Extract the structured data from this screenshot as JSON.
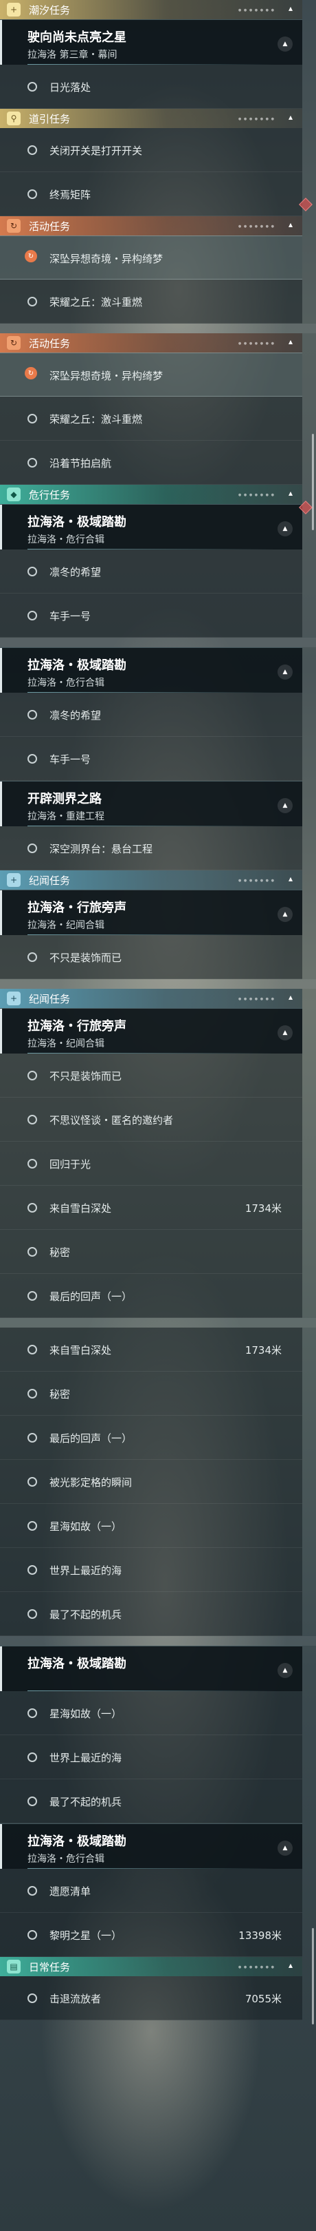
{
  "segments": [
    {
      "type": "cat",
      "style": "gold",
      "icon": "+",
      "icon_name": "sparkle-icon",
      "label": "潮汐任务"
    },
    {
      "type": "quest",
      "title": "驶向尚未点亮之星",
      "subtitle": "拉海洛 第三章・幕间"
    },
    {
      "type": "obj",
      "text": "日光落处"
    },
    {
      "type": "cat",
      "style": "gold",
      "icon": "⚲",
      "icon_name": "location-pin-icon",
      "label": "道引任务"
    },
    {
      "type": "obj",
      "text": "关闭开关是打开开关"
    },
    {
      "type": "obj",
      "text": "终焉矩阵"
    },
    {
      "type": "cat",
      "style": "orange",
      "icon": "↻",
      "icon_name": "cycle-icon",
      "label": "活动任务"
    },
    {
      "type": "obj",
      "text": "深坠异想奇境・异构绮梦",
      "selected": true
    },
    {
      "type": "obj",
      "text": "荣耀之丘：激斗重燃"
    },
    {
      "type": "sep"
    },
    {
      "type": "cat",
      "style": "orange",
      "icon": "↻",
      "icon_name": "cycle-icon",
      "label": "活动任务"
    },
    {
      "type": "obj",
      "text": "深坠异想奇境・异构绮梦",
      "selected": true
    },
    {
      "type": "obj",
      "text": "荣耀之丘：激斗重燃"
    },
    {
      "type": "obj",
      "text": "沿着节拍启航"
    },
    {
      "type": "cat",
      "style": "green",
      "icon": "◆",
      "icon_name": "danger-icon",
      "label": "危行任务"
    },
    {
      "type": "quest",
      "title": "拉海洛・极域踏勘",
      "subtitle": "拉海洛・危行合辑"
    },
    {
      "type": "obj",
      "text": "凛冬的希望"
    },
    {
      "type": "obj",
      "text": "车手一号"
    },
    {
      "type": "sep"
    },
    {
      "type": "quest",
      "title": "拉海洛・极域踏勘",
      "subtitle": "拉海洛・危行合辑"
    },
    {
      "type": "obj",
      "text": "凛冬的希望"
    },
    {
      "type": "obj",
      "text": "车手一号"
    },
    {
      "type": "quest",
      "title": "开辟测界之路",
      "subtitle": "拉海洛・重建工程"
    },
    {
      "type": "obj",
      "text": "深空测界台：悬台工程"
    },
    {
      "type": "cat",
      "style": "blue",
      "icon": "+",
      "icon_name": "sparkle-icon",
      "label": "纪闻任务"
    },
    {
      "type": "quest",
      "title": "拉海洛・行旅旁声",
      "subtitle": "拉海洛・纪闻合辑"
    },
    {
      "type": "obj",
      "text": "不只是装饰而已"
    },
    {
      "type": "sep"
    },
    {
      "type": "cat",
      "style": "blue",
      "icon": "+",
      "icon_name": "sparkle-icon",
      "label": "纪闻任务"
    },
    {
      "type": "quest",
      "title": "拉海洛・行旅旁声",
      "subtitle": "拉海洛・纪闻合辑"
    },
    {
      "type": "obj",
      "text": "不只是装饰而已"
    },
    {
      "type": "obj",
      "text": "不思议怪谈・匿名的邀约者"
    },
    {
      "type": "obj",
      "text": "回归于光"
    },
    {
      "type": "obj",
      "text": "来自雪白深处",
      "distance": "1734米"
    },
    {
      "type": "obj",
      "text": "秘密"
    },
    {
      "type": "obj",
      "text": "最后的回声（一）"
    },
    {
      "type": "sep"
    },
    {
      "type": "obj",
      "text": "来自雪白深处",
      "distance": "1734米"
    },
    {
      "type": "obj",
      "text": "秘密"
    },
    {
      "type": "obj",
      "text": "最后的回声（一）"
    },
    {
      "type": "obj",
      "text": "被光影定格的瞬间"
    },
    {
      "type": "obj",
      "text": "星海如故（一）"
    },
    {
      "type": "obj",
      "text": "世界上最近的海"
    },
    {
      "type": "obj",
      "text": "最了不起的机兵"
    },
    {
      "type": "sep"
    },
    {
      "type": "quest",
      "title": "拉海洛・极域踏勘",
      "subtitle": ""
    },
    {
      "type": "obj",
      "text": "星海如故（一）"
    },
    {
      "type": "obj",
      "text": "世界上最近的海"
    },
    {
      "type": "obj",
      "text": "最了不起的机兵"
    },
    {
      "type": "quest",
      "title": "拉海洛・极域踏勘",
      "subtitle": "拉海洛・危行合辑"
    },
    {
      "type": "obj",
      "text": "遗愿清单"
    },
    {
      "type": "obj",
      "text": "黎明之星（一）",
      "distance": "13398米"
    },
    {
      "type": "cat",
      "style": "green",
      "icon": "▤",
      "icon_name": "calendar-icon",
      "label": "日常任务"
    },
    {
      "type": "obj",
      "text": "击退流放者",
      "distance": "7055米"
    }
  ]
}
